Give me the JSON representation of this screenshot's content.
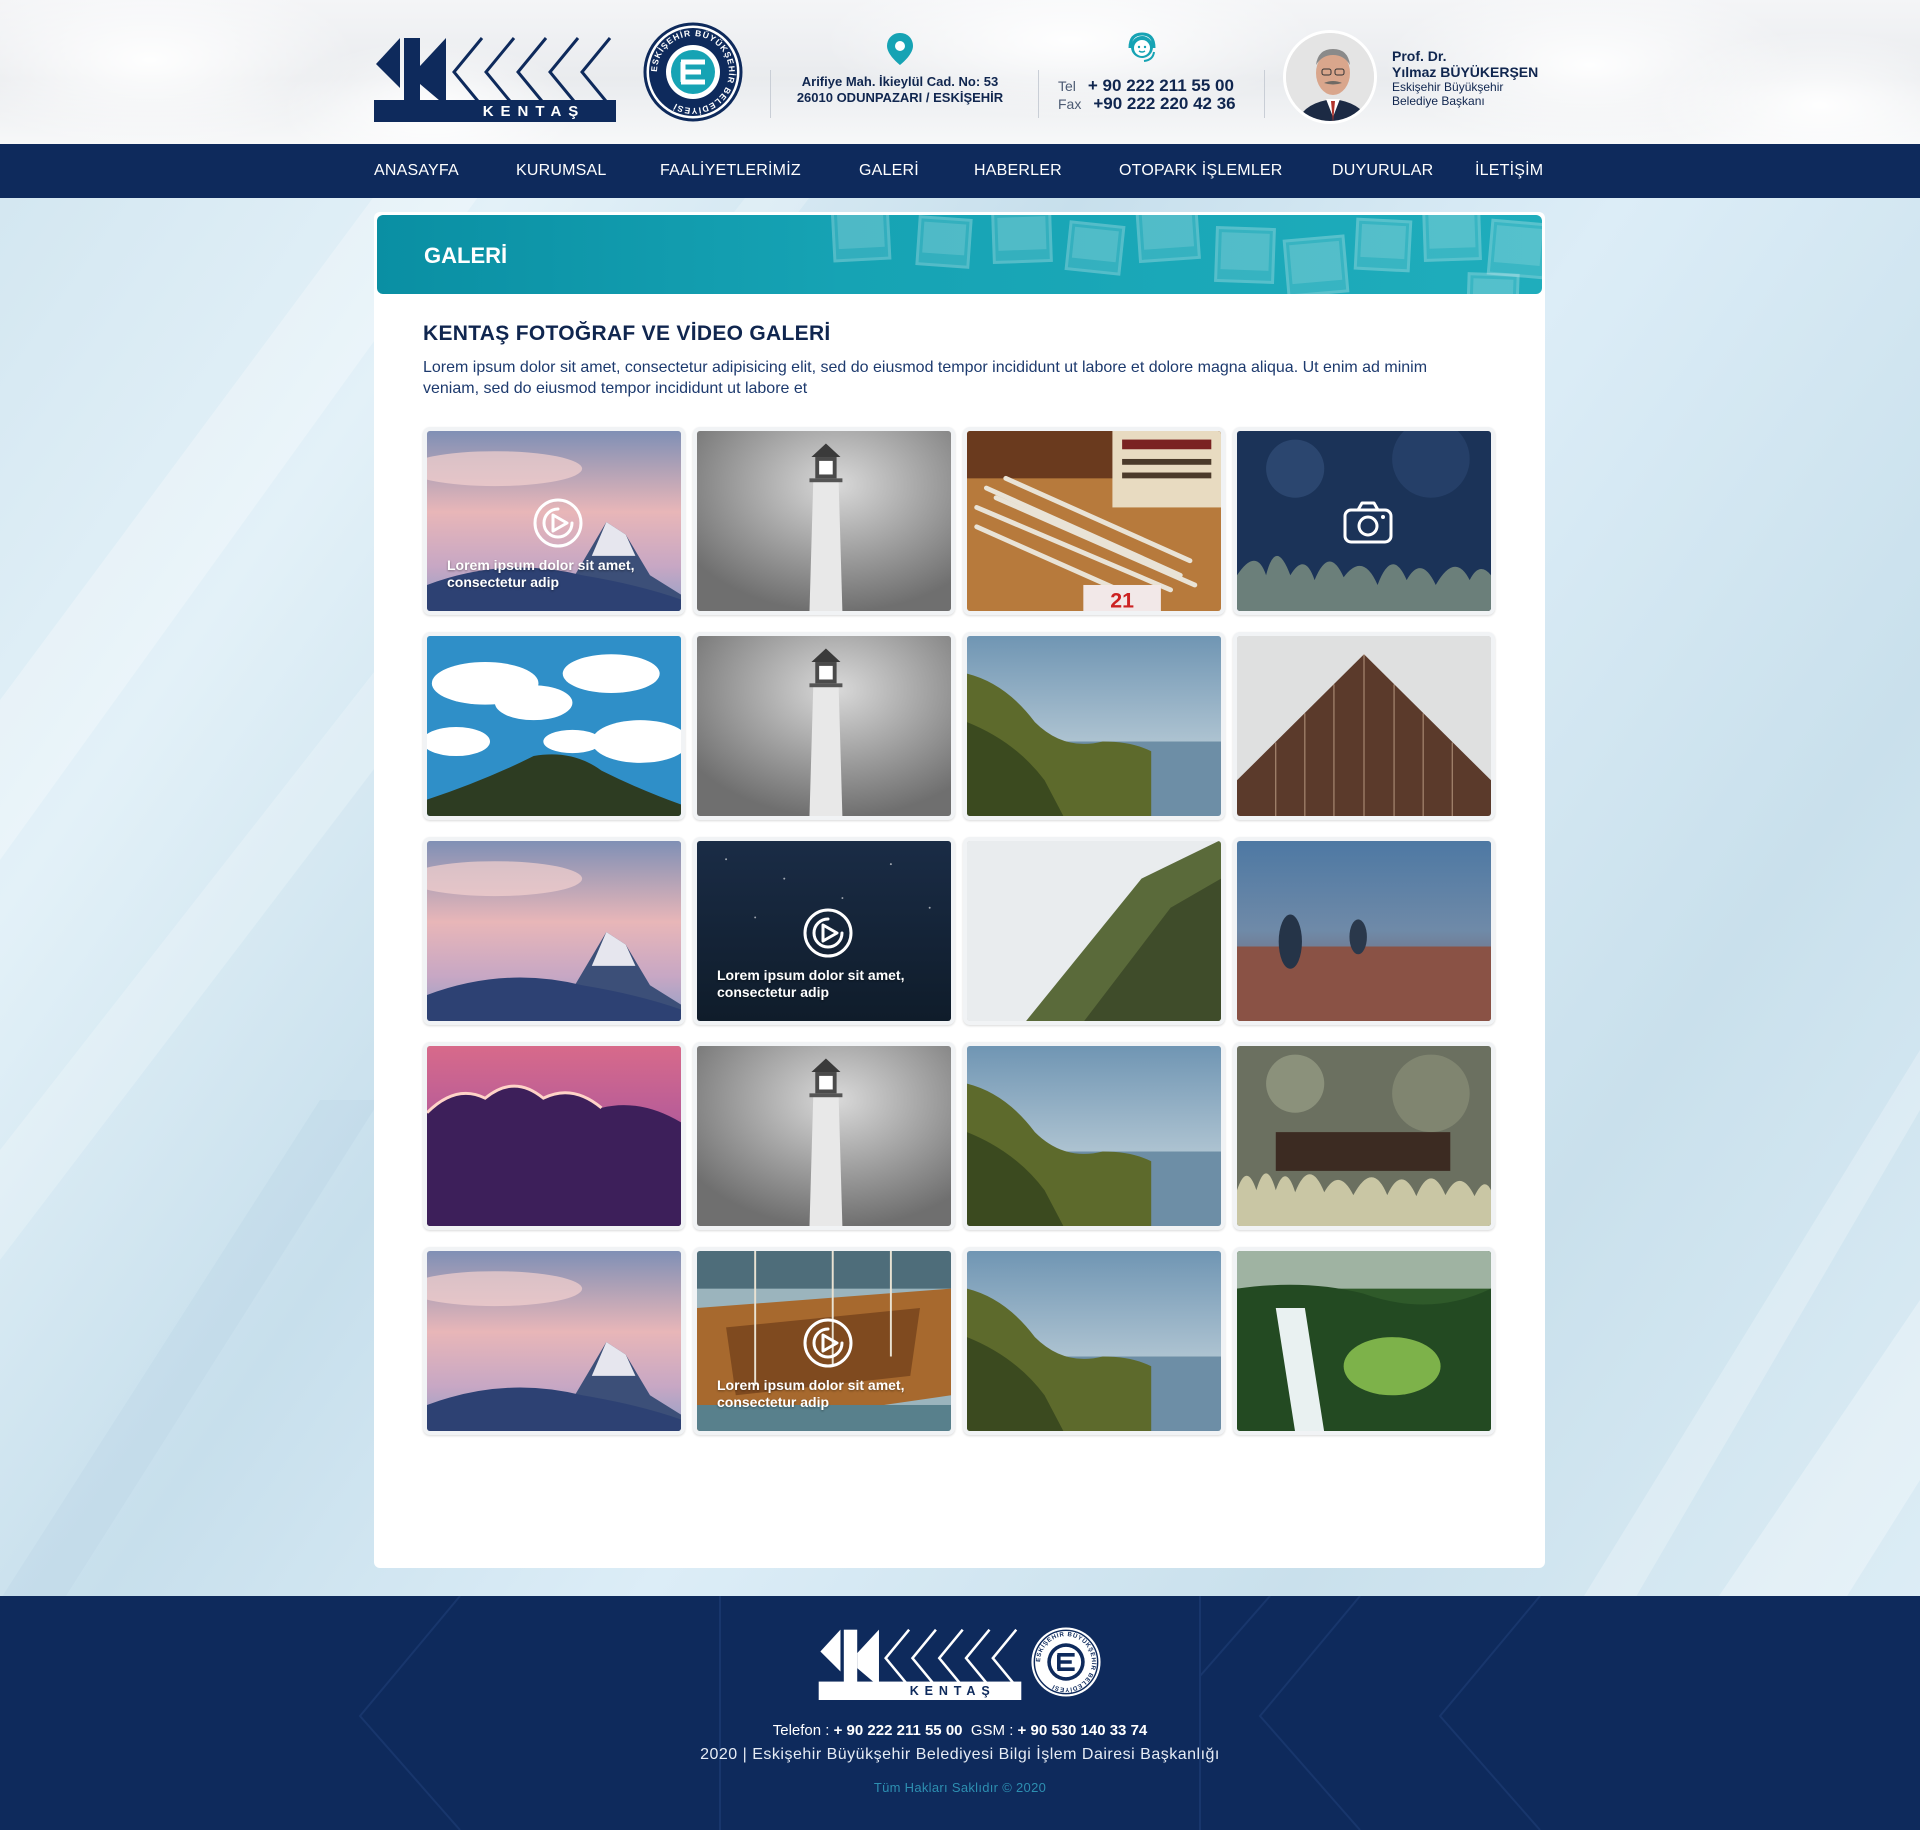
{
  "header": {
    "address_line1": "Arifiye Mah. İkieylül Cad. No: 53",
    "address_line2": "26010 ODUNPAZARI / ESKİŞEHİR",
    "tel_label": "Tel",
    "tel_value": "+ 90 222 211 55 00",
    "fax_label": "Fax",
    "fax_value": "+90 222 220 42 36",
    "mayor_title": "Prof. Dr.",
    "mayor_name": "Yılmaz BÜYÜKERŞEN",
    "mayor_role_line1": "Eskişehir Büyükşehir",
    "mayor_role_line2": "Belediye Başkanı",
    "logo_text": "KENTAŞ",
    "seal_text": "ESKİŞEHİR BÜYÜKŞEHİR BELEDİYESİ"
  },
  "nav": {
    "items": [
      {
        "label": "ANASAYFA"
      },
      {
        "label": "KURUMSAL"
      },
      {
        "label": "FAALİYETLERİMİZ"
      },
      {
        "label": "GALERİ"
      },
      {
        "label": "HABERLER"
      },
      {
        "label": "OTOPARK İŞLEMLER"
      },
      {
        "label": "DUYURULAR"
      },
      {
        "label": "İLETİŞİM"
      }
    ]
  },
  "page": {
    "banner_title": "GALERİ",
    "gallery_title": "KENTAŞ FOTOĞRAF VE VİDEO GALERİ",
    "gallery_description": "Lorem ipsum dolor sit amet, consectetur adipisicing elit, sed do eiusmod tempor incididunt ut labore et dolore magna aliqua. Ut enim ad minim veniam, sed do eiusmod tempor incididunt ut labore et"
  },
  "gallery": [
    {
      "scene": "matterhorn-sunset",
      "icon": "play-icon",
      "caption": "Lorem ipsum dolor sit amet, consectetur adip"
    },
    {
      "scene": "lighthouse",
      "icon": "",
      "caption": ""
    },
    {
      "scene": "pencils-desk",
      "icon": "",
      "caption": ""
    },
    {
      "scene": "dark-grass",
      "icon": "camera-icon",
      "caption": ""
    },
    {
      "scene": "sky-clouds-hill",
      "icon": "",
      "caption": ""
    },
    {
      "scene": "lighthouse",
      "icon": "",
      "caption": ""
    },
    {
      "scene": "coast-cliffs",
      "icon": "",
      "caption": ""
    },
    {
      "scene": "building-facade",
      "icon": "",
      "caption": ""
    },
    {
      "scene": "matterhorn-sunset",
      "icon": "",
      "caption": ""
    },
    {
      "scene": "night-sky",
      "icon": "play-icon",
      "caption": "Lorem ipsum dolor sit amet, consectetur adip"
    },
    {
      "scene": "foggy-forest-slope",
      "icon": "",
      "caption": ""
    },
    {
      "scene": "misty-field-people",
      "icon": "",
      "caption": ""
    },
    {
      "scene": "purple-cloud-sunset",
      "icon": "",
      "caption": ""
    },
    {
      "scene": "lighthouse",
      "icon": "",
      "caption": ""
    },
    {
      "scene": "coast-cliffs",
      "icon": "",
      "caption": ""
    },
    {
      "scene": "bokeh-grass",
      "icon": "",
      "caption": ""
    },
    {
      "scene": "matterhorn-sunset",
      "icon": "",
      "caption": ""
    },
    {
      "scene": "harbor-boat",
      "icon": "play-icon",
      "caption": "Lorem ipsum dolor sit amet, consectetur adip"
    },
    {
      "scene": "coast-cliffs",
      "icon": "",
      "caption": ""
    },
    {
      "scene": "waterfall-forest",
      "icon": "",
      "caption": ""
    }
  ],
  "footer": {
    "phone_label": "Telefon :",
    "phone_value": "+ 90 222 211 55 00",
    "gsm_label": "GSM :",
    "gsm_value": "+ 90 530 140 33 74",
    "org_line": "2020 | Eskişehir Büyükşehir Belediyesi Bilgi İşlem Dairesi Başkanlığı",
    "copyright": "Tüm Hakları Saklıdır © 2020"
  },
  "colors": {
    "navy": "#0e2a5c",
    "teal": "#16a3b4",
    "page_bg": "#d5e8f2"
  }
}
